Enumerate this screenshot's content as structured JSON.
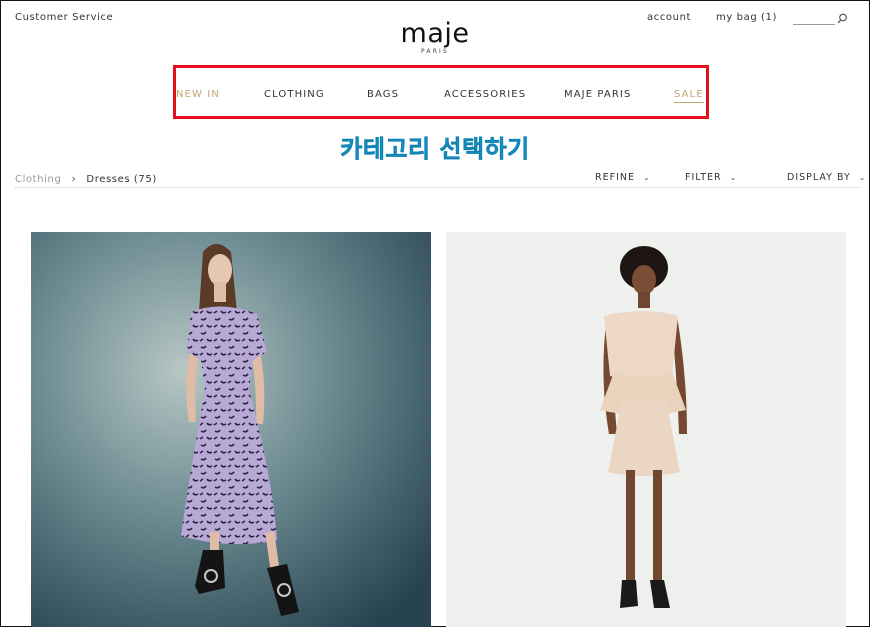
{
  "header": {
    "customer_service": "Customer Service",
    "logo": "maje",
    "logo_sub": "PARIS",
    "account": "account",
    "bag": "my bag (1)",
    "search_icon": "search-icon"
  },
  "nav": {
    "items": [
      {
        "label": "NEW IN"
      },
      {
        "label": "CLOTHING"
      },
      {
        "label": "BAGS"
      },
      {
        "label": "ACCESSORIES"
      },
      {
        "label": "MAJE PARIS"
      },
      {
        "label": "SALE"
      }
    ],
    "highlight_color": "#e4101a",
    "accent_color": "#c4a574"
  },
  "annotation": {
    "text": "카테고리 선택하기",
    "color": "#19a4d8"
  },
  "breadcrumb": {
    "level1": "Clothing",
    "separator": "›",
    "level2": "Dresses (75)"
  },
  "toolbar": {
    "refine": "REFINE",
    "filter": "FILTER",
    "display_by": "DISPLAY BY",
    "chevron_icon": "chevron-down-icon"
  },
  "products": [
    {
      "image": "model in purple floral midi dress and black ankle boots"
    },
    {
      "image": "model in cream sleeveless top and peplum skirt set"
    }
  ]
}
